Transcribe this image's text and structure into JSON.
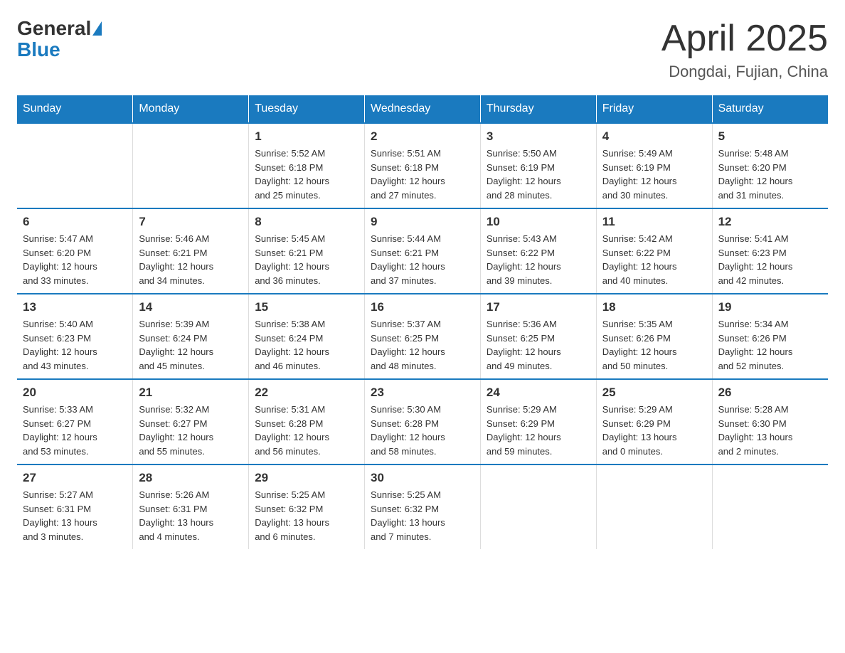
{
  "header": {
    "logo_general": "General",
    "logo_blue": "Blue",
    "month_year": "April 2025",
    "location": "Dongdai, Fujian, China"
  },
  "days_of_week": [
    "Sunday",
    "Monday",
    "Tuesday",
    "Wednesday",
    "Thursday",
    "Friday",
    "Saturday"
  ],
  "weeks": [
    [
      {
        "day": "",
        "info": ""
      },
      {
        "day": "",
        "info": ""
      },
      {
        "day": "1",
        "info": "Sunrise: 5:52 AM\nSunset: 6:18 PM\nDaylight: 12 hours\nand 25 minutes."
      },
      {
        "day": "2",
        "info": "Sunrise: 5:51 AM\nSunset: 6:18 PM\nDaylight: 12 hours\nand 27 minutes."
      },
      {
        "day": "3",
        "info": "Sunrise: 5:50 AM\nSunset: 6:19 PM\nDaylight: 12 hours\nand 28 minutes."
      },
      {
        "day": "4",
        "info": "Sunrise: 5:49 AM\nSunset: 6:19 PM\nDaylight: 12 hours\nand 30 minutes."
      },
      {
        "day": "5",
        "info": "Sunrise: 5:48 AM\nSunset: 6:20 PM\nDaylight: 12 hours\nand 31 minutes."
      }
    ],
    [
      {
        "day": "6",
        "info": "Sunrise: 5:47 AM\nSunset: 6:20 PM\nDaylight: 12 hours\nand 33 minutes."
      },
      {
        "day": "7",
        "info": "Sunrise: 5:46 AM\nSunset: 6:21 PM\nDaylight: 12 hours\nand 34 minutes."
      },
      {
        "day": "8",
        "info": "Sunrise: 5:45 AM\nSunset: 6:21 PM\nDaylight: 12 hours\nand 36 minutes."
      },
      {
        "day": "9",
        "info": "Sunrise: 5:44 AM\nSunset: 6:21 PM\nDaylight: 12 hours\nand 37 minutes."
      },
      {
        "day": "10",
        "info": "Sunrise: 5:43 AM\nSunset: 6:22 PM\nDaylight: 12 hours\nand 39 minutes."
      },
      {
        "day": "11",
        "info": "Sunrise: 5:42 AM\nSunset: 6:22 PM\nDaylight: 12 hours\nand 40 minutes."
      },
      {
        "day": "12",
        "info": "Sunrise: 5:41 AM\nSunset: 6:23 PM\nDaylight: 12 hours\nand 42 minutes."
      }
    ],
    [
      {
        "day": "13",
        "info": "Sunrise: 5:40 AM\nSunset: 6:23 PM\nDaylight: 12 hours\nand 43 minutes."
      },
      {
        "day": "14",
        "info": "Sunrise: 5:39 AM\nSunset: 6:24 PM\nDaylight: 12 hours\nand 45 minutes."
      },
      {
        "day": "15",
        "info": "Sunrise: 5:38 AM\nSunset: 6:24 PM\nDaylight: 12 hours\nand 46 minutes."
      },
      {
        "day": "16",
        "info": "Sunrise: 5:37 AM\nSunset: 6:25 PM\nDaylight: 12 hours\nand 48 minutes."
      },
      {
        "day": "17",
        "info": "Sunrise: 5:36 AM\nSunset: 6:25 PM\nDaylight: 12 hours\nand 49 minutes."
      },
      {
        "day": "18",
        "info": "Sunrise: 5:35 AM\nSunset: 6:26 PM\nDaylight: 12 hours\nand 50 minutes."
      },
      {
        "day": "19",
        "info": "Sunrise: 5:34 AM\nSunset: 6:26 PM\nDaylight: 12 hours\nand 52 minutes."
      }
    ],
    [
      {
        "day": "20",
        "info": "Sunrise: 5:33 AM\nSunset: 6:27 PM\nDaylight: 12 hours\nand 53 minutes."
      },
      {
        "day": "21",
        "info": "Sunrise: 5:32 AM\nSunset: 6:27 PM\nDaylight: 12 hours\nand 55 minutes."
      },
      {
        "day": "22",
        "info": "Sunrise: 5:31 AM\nSunset: 6:28 PM\nDaylight: 12 hours\nand 56 minutes."
      },
      {
        "day": "23",
        "info": "Sunrise: 5:30 AM\nSunset: 6:28 PM\nDaylight: 12 hours\nand 58 minutes."
      },
      {
        "day": "24",
        "info": "Sunrise: 5:29 AM\nSunset: 6:29 PM\nDaylight: 12 hours\nand 59 minutes."
      },
      {
        "day": "25",
        "info": "Sunrise: 5:29 AM\nSunset: 6:29 PM\nDaylight: 13 hours\nand 0 minutes."
      },
      {
        "day": "26",
        "info": "Sunrise: 5:28 AM\nSunset: 6:30 PM\nDaylight: 13 hours\nand 2 minutes."
      }
    ],
    [
      {
        "day": "27",
        "info": "Sunrise: 5:27 AM\nSunset: 6:31 PM\nDaylight: 13 hours\nand 3 minutes."
      },
      {
        "day": "28",
        "info": "Sunrise: 5:26 AM\nSunset: 6:31 PM\nDaylight: 13 hours\nand 4 minutes."
      },
      {
        "day": "29",
        "info": "Sunrise: 5:25 AM\nSunset: 6:32 PM\nDaylight: 13 hours\nand 6 minutes."
      },
      {
        "day": "30",
        "info": "Sunrise: 5:25 AM\nSunset: 6:32 PM\nDaylight: 13 hours\nand 7 minutes."
      },
      {
        "day": "",
        "info": ""
      },
      {
        "day": "",
        "info": ""
      },
      {
        "day": "",
        "info": ""
      }
    ]
  ]
}
